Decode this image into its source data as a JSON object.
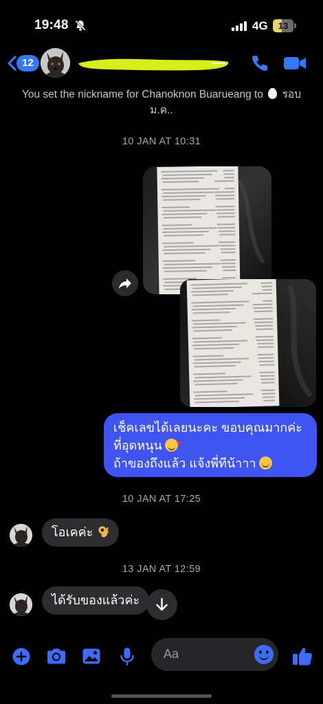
{
  "status_bar": {
    "time": "19:48",
    "network": "4G",
    "battery_level": "13",
    "battery_fraction": 0.13
  },
  "header": {
    "unread_count": "12",
    "contact_name_redacted": true,
    "accent_color": "#3478f6",
    "highlight_color": "#d6ee1a"
  },
  "system_message": {
    "text": "You set the nickname for Chanoknon Buarueang to",
    "nickname": "รอบ ม.ค.."
  },
  "messages": {
    "date_1": "10 JAN AT 10:31",
    "outgoing_text_line1": "เช็คเลขได้เลยนะคะ ขอบคุณมากค่ะ",
    "outgoing_text_line2": "ที่อุดหนุน",
    "outgoing_text_line3": "ถ้าของถึงแล้ว แจ้งพี่ทีน้าาา",
    "outgoing_color": "#3f54f0",
    "date_2": "10 JAN AT 17:25",
    "incoming_1": "โอเคค่ะ",
    "date_3": "13 JAN AT 12:59",
    "incoming_2": "ได้รับของแล้วค่ะ",
    "incoming_color": "#2d2d2f"
  },
  "composer": {
    "placeholder": "Aa"
  },
  "icons": {
    "share": "share-icon",
    "scroll": "arrow-down-icon",
    "plus": "plus-circle-icon",
    "camera": "camera-icon",
    "gallery": "image-icon",
    "mic": "microphone-icon",
    "emoji": "smiley-icon",
    "like": "thumbs-up-icon"
  }
}
